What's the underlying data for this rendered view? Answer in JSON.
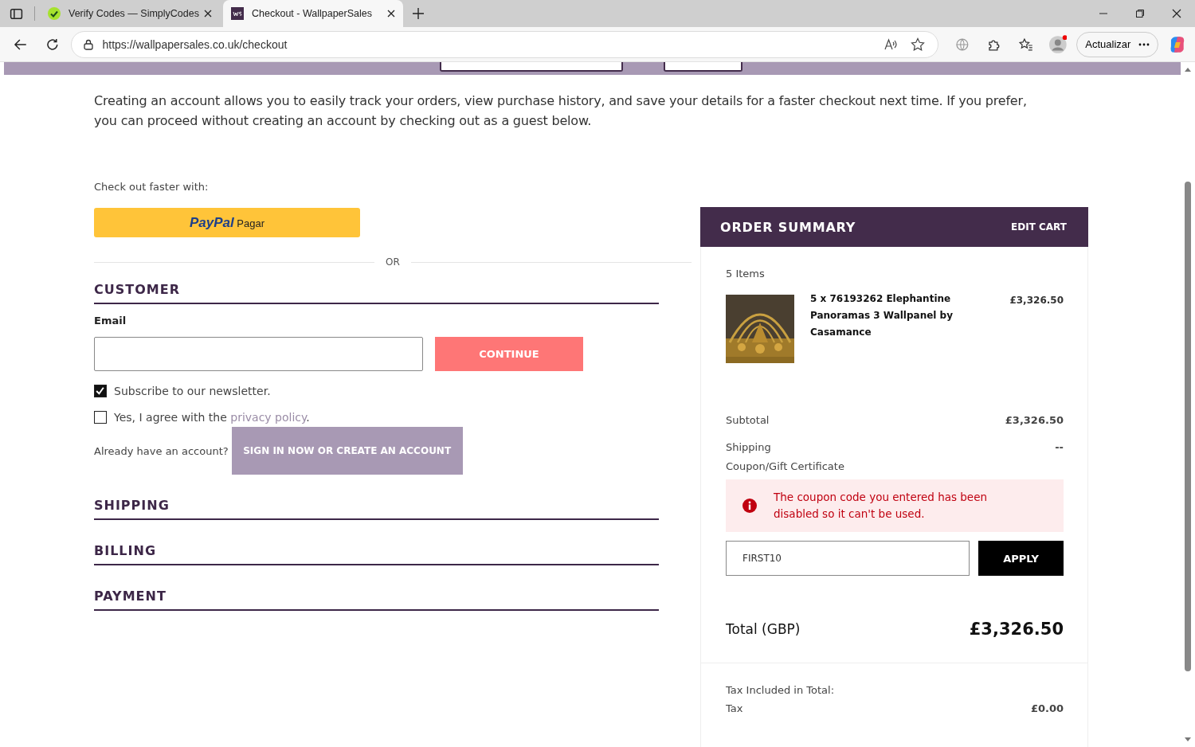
{
  "browser": {
    "tabs": [
      {
        "title": "Verify Codes — SimplyCodes",
        "selected": false,
        "kind": "check"
      },
      {
        "title": "Checkout - WallpaperSales",
        "selected": true,
        "kind": "site"
      }
    ],
    "url": "https://wallpapersales.co.uk/checkout",
    "update_button": "Actualizar"
  },
  "intro": "Creating an account allows you to easily track your orders, view purchase history, and save your details for a faster checkout next time. If you prefer, you can proceed without creating an account by checking out as a guest below.",
  "express": {
    "label": "Check out faster with:",
    "paypal_logo": "PayPal",
    "paypal_label": "Pagar"
  },
  "divider": "OR",
  "customer": {
    "heading": "CUSTOMER",
    "email_label": "Email",
    "continue_button": "CONTINUE",
    "checkboxes": [
      {
        "label": "Subscribe to our newsletter.",
        "checked": true
      },
      {
        "label": "Yes, I agree with the",
        "link": "privacy policy",
        "after": ".",
        "checked": false
      }
    ],
    "account_prompt": "Already have an account?",
    "sign_in_button": "SIGN IN NOW OR CREATE AN ACCOUNT"
  },
  "sections": [
    "SHIPPING",
    "BILLING",
    "PAYMENT"
  ],
  "summary": {
    "title": "ORDER SUMMARY",
    "edit_cart": "EDIT CART",
    "item_count": "5 Items",
    "items": [
      {
        "name": "5 x 76193262 Elephantine Panoramas 3 Wallpanel by Casamance",
        "price": "£3,326.50",
        "kind": "picture"
      }
    ],
    "rows": [
      {
        "label": "Subtotal",
        "value": "£3,326.50"
      },
      {
        "label": "Shipping",
        "value": "--"
      }
    ],
    "coupon_label": "Coupon/Gift Certificate",
    "coupon_error": "The coupon code you entered has been disabled so it can't be used.",
    "coupon_value": "FIRST10",
    "apply_button": "APPLY",
    "total_label": "Total (GBP)",
    "total_value": "£3,326.50",
    "tax_heading": "Tax Included in Total:",
    "tax_rows": [
      {
        "label": "Tax",
        "value": "£0.00"
      }
    ]
  }
}
